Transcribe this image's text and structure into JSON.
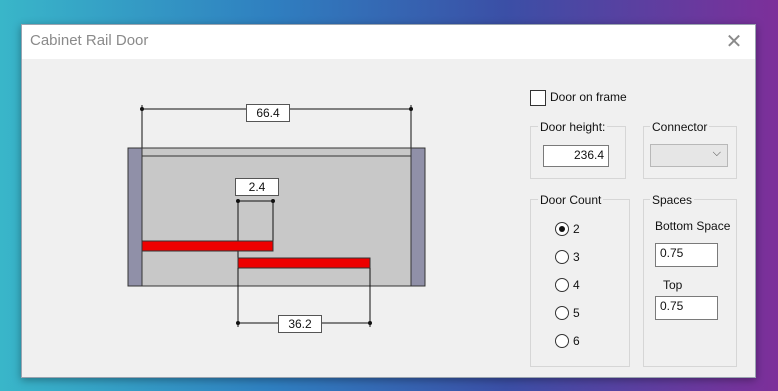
{
  "window": {
    "title": "Cabinet Rail Door",
    "close_icon": "close-icon"
  },
  "drawing": {
    "overall_width": "66.4",
    "gap": "2.4",
    "door_width": "36.2",
    "door_color": "#ee0000",
    "panel_color": "#c8c8c8",
    "side_color": "#9090a8"
  },
  "door_on_frame": {
    "label": "Door on frame",
    "checked": false
  },
  "door_height": {
    "label": "Door height:",
    "value": "236.4"
  },
  "connector": {
    "label": "Connector",
    "value": ""
  },
  "door_count": {
    "label": "Door Count",
    "options": [
      "2",
      "3",
      "4",
      "5",
      "6"
    ],
    "selected": "2"
  },
  "spaces": {
    "label": "Spaces",
    "bottom_label": "Bottom Space",
    "bottom_value": "0.75",
    "top_label": "Top",
    "top_value": "0.75"
  }
}
